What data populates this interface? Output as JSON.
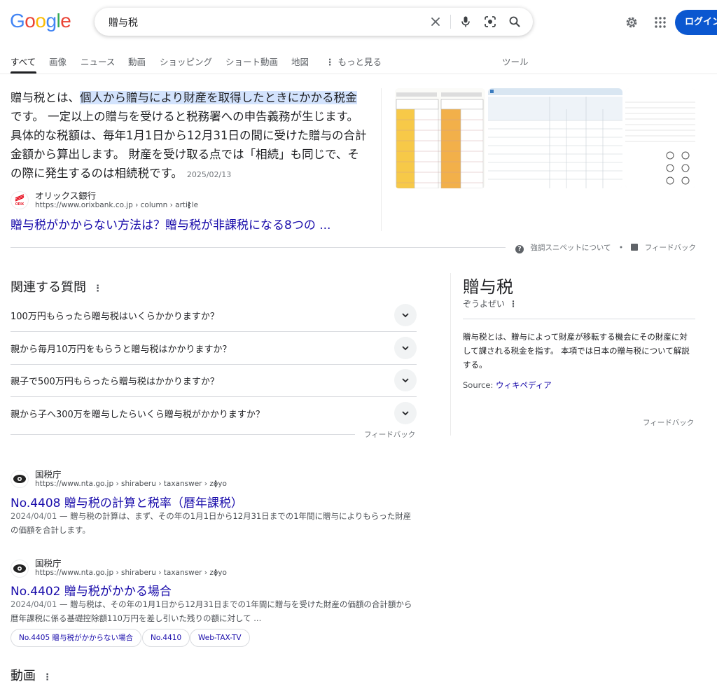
{
  "logo": {
    "letters": [
      "G",
      "o",
      "o",
      "g",
      "l",
      "e"
    ],
    "colors": [
      "#4285F4",
      "#EA4335",
      "#FBBC05",
      "#4285F4",
      "#34A853",
      "#EA4335"
    ]
  },
  "search": {
    "query": "贈与税"
  },
  "header": {
    "login_label": "ログイン"
  },
  "tabs": [
    "すべて",
    "画像",
    "ニュース",
    "動画",
    "ショッピング",
    "ショート動画",
    "地図",
    "もっと見る",
    "ツール"
  ],
  "featured": {
    "text_before": "贈与税とは、",
    "text_highlight": "個人から贈与により財産を取得したときにかかる税金",
    "text_after": "です。 一定以上の贈与を受けると税務署への申告義務が生じます。 具体的な税額は、毎年1月1日から12月31日の間に受けた贈与の合計金額から算出します。 財産を受け取る点では「相続」も同じで、その際に発生するのは相続税です。",
    "date": "2025/02/13",
    "site_name": "オリックス銀行",
    "favicon_text": "ORIX",
    "url": "https://www.orixbank.co.jp › column › article",
    "link": "贈与税がかからない方法は？贈与税が非課税になる8つの ...",
    "about_label": "強調スニペットについて",
    "dot": "•",
    "feedback_label": "フィードバック"
  },
  "paa": {
    "title": "関連する質問",
    "questions": [
      "100万円もらったら贈与税はいくらかかりますか？",
      "親から毎月10万円をもらうと贈与税はかかりますか？",
      "親子で500万円もらったら贈与税はかかりますか？",
      "親から子へ300万を贈与したらいくら贈与税がかかりますか？"
    ],
    "feedback_label": "フィードバック"
  },
  "knowledge_panel": {
    "title": "贈与税",
    "reading": "ぞうよぜい",
    "description": "贈与税とは、贈与によって財産が移転する機会にその財産に対して課される税金を指す。 本項では日本の贈与税について解説する。",
    "source_label": "Source:",
    "source_link": "ウィキペディア",
    "feedback_label": "フィードバック"
  },
  "results": [
    {
      "site_name": "国税庁",
      "url": "https://www.nta.go.jp › shiraberu › taxanswer › zoyo",
      "title": "No.4408 贈与税の計算と税率（暦年課税）",
      "date": "2024/04/01",
      "snippet": "贈与税の計算は、まず、その年の1月1日から12月31日までの1年間に贈与によりもらった財産の価額を合計します。"
    },
    {
      "site_name": "国税庁",
      "url": "https://www.nta.go.jp › shiraberu › taxanswer › zoyo",
      "title": "No.4402 贈与税がかかる場合",
      "date": "2024/04/01",
      "snippet": "贈与税は、その年の1月1日から12月31日までの1年間に贈与を受けた財産の価額の合計額から暦年課税に係る基礎控除額110万円を差し引いた残りの額に対して ...",
      "chips": [
        "No.4405 贈与税がかからない場合",
        "No.4410",
        "Web-TAX-TV"
      ]
    }
  ],
  "video_section": {
    "title": "動画"
  }
}
